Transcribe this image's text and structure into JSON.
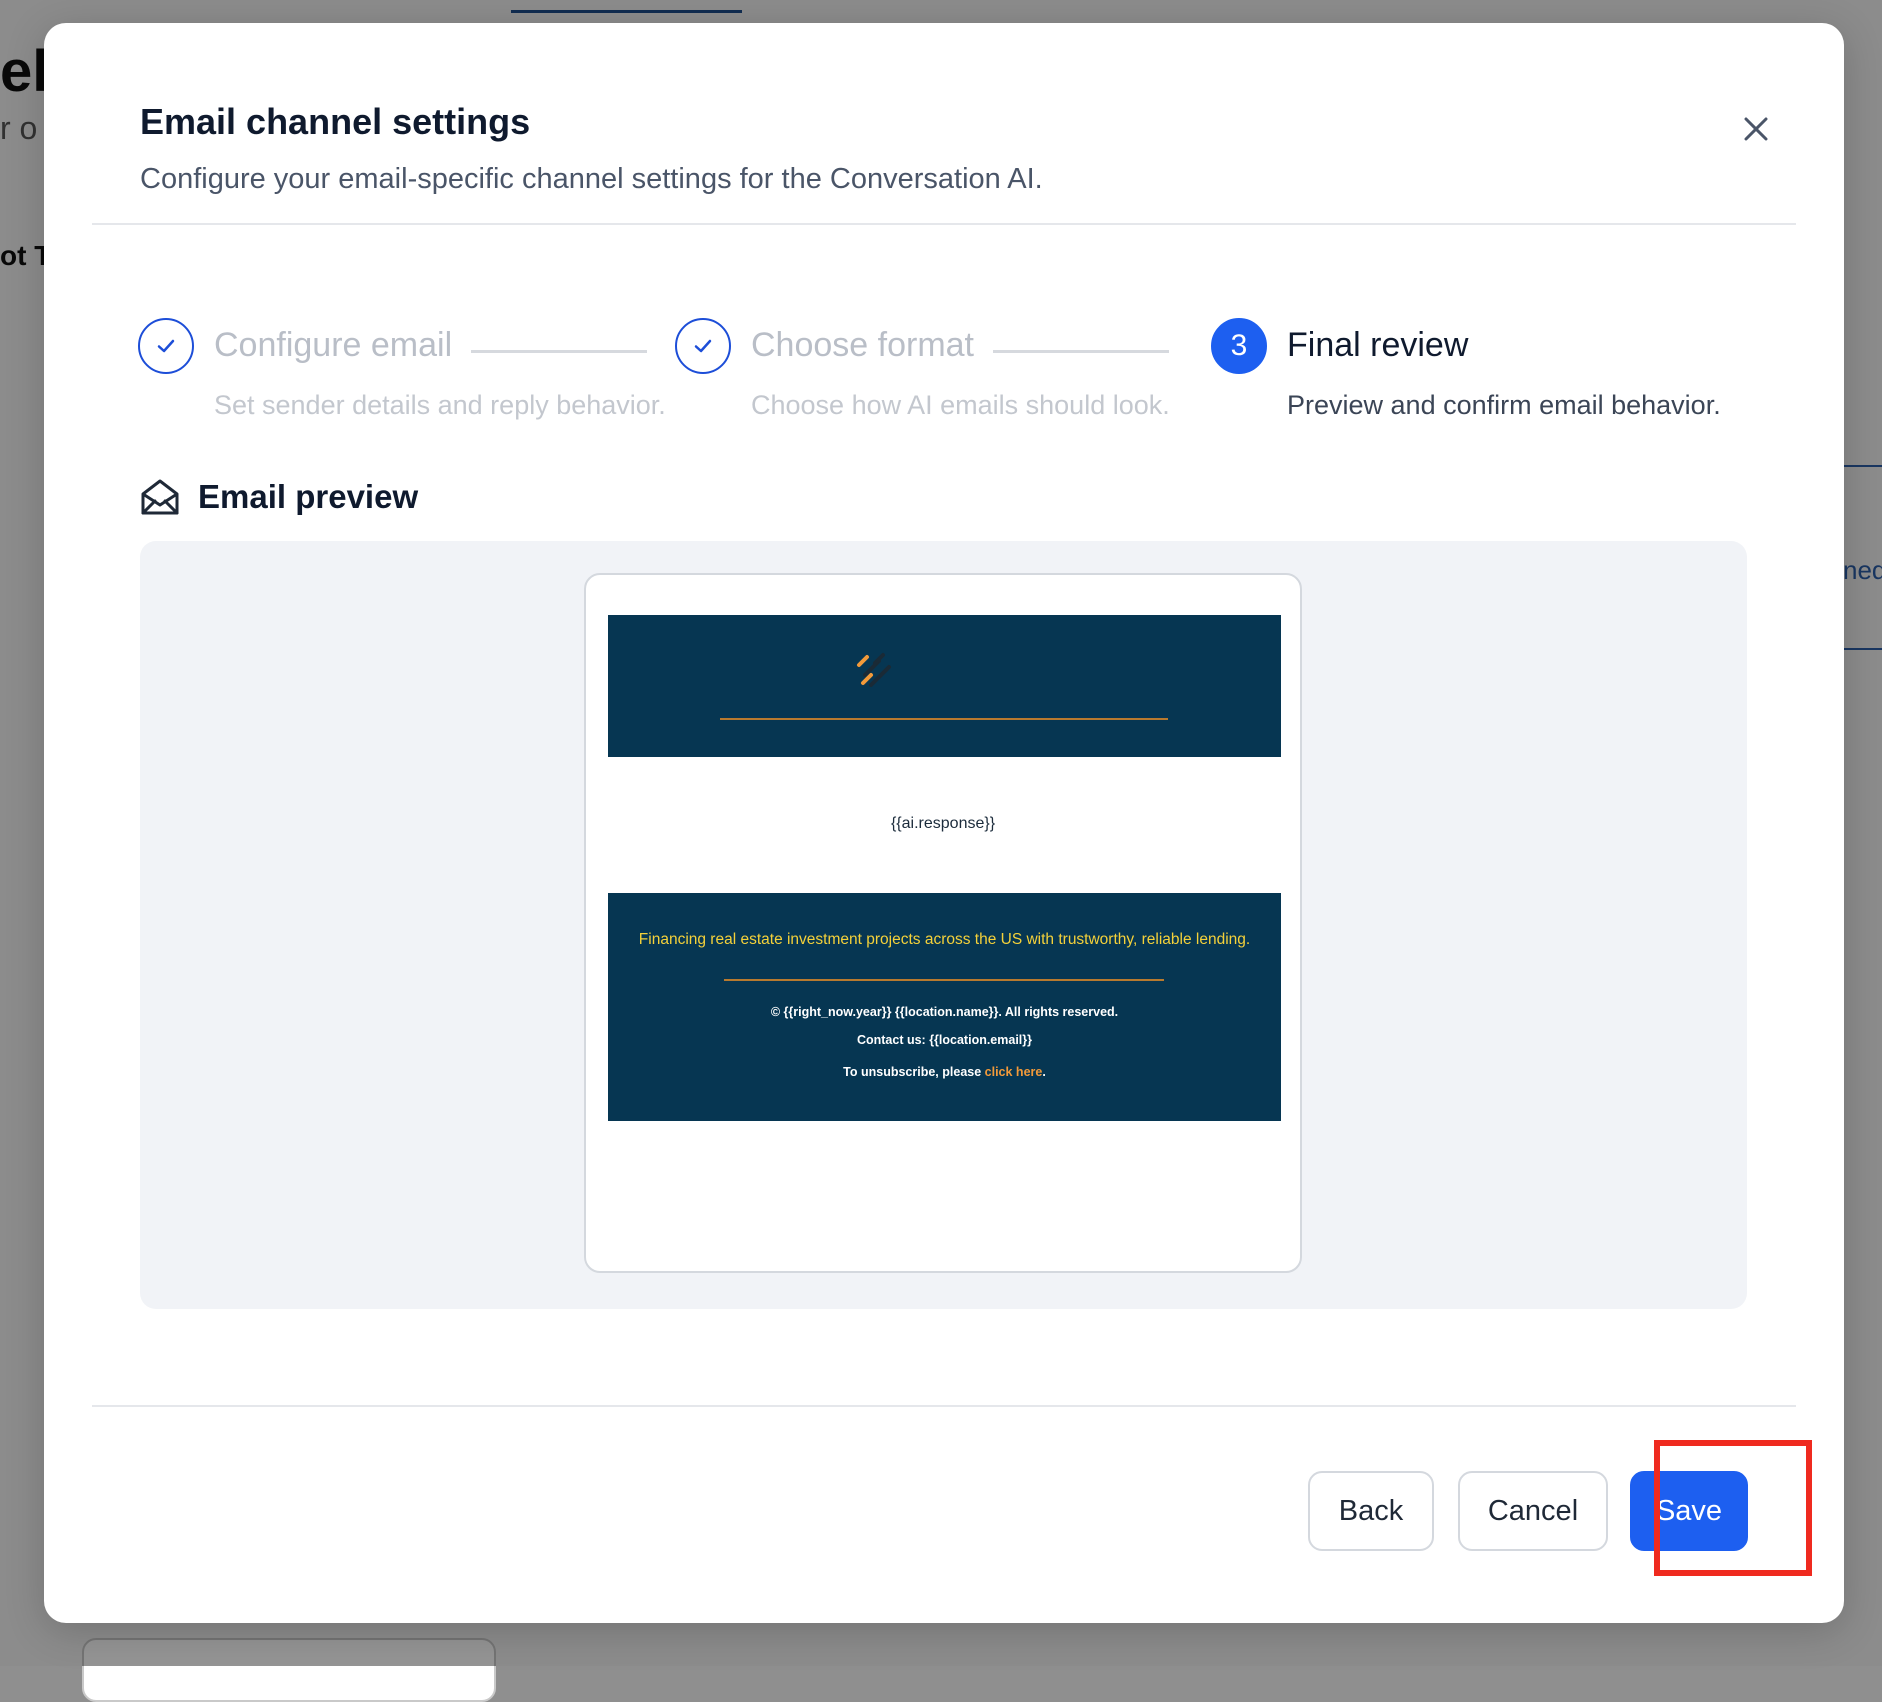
{
  "background": {
    "fragment_title": "el",
    "fragment_subtitle": "r o",
    "fragment_tab": "ot Tr",
    "fragment_right": "ned"
  },
  "modal": {
    "title": "Email channel settings",
    "subtitle": "Configure your email-specific channel settings for the Conversation AI.",
    "close_icon": "close-icon"
  },
  "stepper": {
    "steps": [
      {
        "label": "Configure email",
        "description": "Set sender details and reply behavior.",
        "state": "completed"
      },
      {
        "label": "Choose format",
        "description": "Choose how AI emails should look.",
        "state": "completed"
      },
      {
        "number": "3",
        "label": "Final review",
        "description": "Preview and confirm email behavior.",
        "state": "active"
      }
    ]
  },
  "preview": {
    "heading": "Email preview",
    "icon": "envelope-open-icon",
    "email": {
      "body_placeholder": "{{ai.response}}",
      "tagline": "Financing real estate investment projects across the US with trustworthy, reliable lending.",
      "copyright": "© {{right_now.year}} {{location.name}}. All rights reserved.",
      "contact": "Contact us: {{location.email}}",
      "unsubscribe_prefix": "To unsubscribe, please ",
      "unsubscribe_link": "click here",
      "unsubscribe_suffix": "."
    }
  },
  "footer": {
    "back_label": "Back",
    "cancel_label": "Cancel",
    "save_label": "Save"
  },
  "colors": {
    "primary": "#1d5ff0",
    "email_dark": "#063652",
    "email_accent": "#b87a2f",
    "tagline_yellow": "#f4d13a",
    "highlight": "#ef2a1f"
  }
}
